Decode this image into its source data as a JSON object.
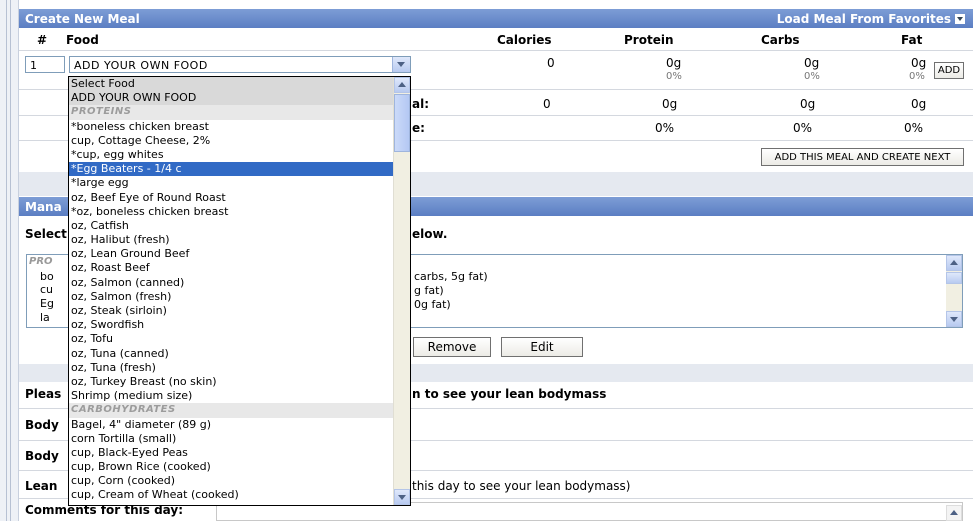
{
  "create_meal": {
    "title": "Create New Meal",
    "load_favorites": "Load Meal From Favorites",
    "columns": {
      "num": "#",
      "food": "Food",
      "calories": "Calories",
      "protein": "Protein",
      "carbs": "Carbs",
      "fat": "Fat"
    },
    "row": {
      "number": "1",
      "food_value": "ADD YOUR OWN FOOD",
      "calories": "0",
      "protein": "0g",
      "protein_pct": "0%",
      "carbs": "0g",
      "carbs_pct": "0%",
      "fat": "0g",
      "fat_pct": "0%",
      "add_label": "ADD"
    },
    "totals": {
      "label_fragment": "al:",
      "calories": "0",
      "protein": "0g",
      "carbs": "0g",
      "fat": "0g"
    },
    "percentages": {
      "label_fragment": "e:",
      "protein": "0%",
      "carbs": "0%",
      "fat": "0%"
    },
    "add_meal_next": "ADD THIS MEAL AND CREATE NEXT"
  },
  "dropdown": {
    "items": [
      {
        "label": "Select Food",
        "kind": "shaded"
      },
      {
        "label": "ADD YOUR OWN FOOD",
        "kind": "shaded"
      },
      {
        "label": "PROTEINS",
        "kind": "group"
      },
      {
        "label": "*boneless chicken breast",
        "kind": "item"
      },
      {
        "label": "cup, Cottage Cheese, 2%",
        "kind": "item"
      },
      {
        "label": "*cup, egg whites",
        "kind": "item"
      },
      {
        "label": "*Egg Beaters - 1/4 c",
        "kind": "selected"
      },
      {
        "label": "*large egg",
        "kind": "item"
      },
      {
        "label": "oz, Beef Eye of Round Roast",
        "kind": "item"
      },
      {
        "label": "*oz, boneless chicken breast",
        "kind": "item"
      },
      {
        "label": "oz, Catfish",
        "kind": "item"
      },
      {
        "label": "oz, Halibut (fresh)",
        "kind": "item"
      },
      {
        "label": "oz, Lean Ground Beef",
        "kind": "item"
      },
      {
        "label": "oz, Roast Beef",
        "kind": "item"
      },
      {
        "label": "oz, Salmon (canned)",
        "kind": "item"
      },
      {
        "label": "oz, Salmon (fresh)",
        "kind": "item"
      },
      {
        "label": "oz, Steak (sirloin)",
        "kind": "item"
      },
      {
        "label": "oz, Swordfish",
        "kind": "item"
      },
      {
        "label": "oz, Tofu",
        "kind": "item"
      },
      {
        "label": "oz, Tuna (canned)",
        "kind": "item"
      },
      {
        "label": "oz, Tuna (fresh)",
        "kind": "item"
      },
      {
        "label": "oz, Turkey Breast (no skin)",
        "kind": "item"
      },
      {
        "label": "Shrimp (medium size)",
        "kind": "item"
      },
      {
        "label": "CARBOHYDRATES",
        "kind": "group"
      },
      {
        "label": "Bagel, 4\" diameter (89 g)",
        "kind": "item"
      },
      {
        "label": "corn Tortilla (small)",
        "kind": "item"
      },
      {
        "label": "cup, Black-Eyed Peas",
        "kind": "item"
      },
      {
        "label": "cup, Brown Rice (cooked)",
        "kind": "item"
      },
      {
        "label": "cup, Corn (cooked)",
        "kind": "item"
      },
      {
        "label": "cup, Cream of Wheat (cooked)",
        "kind": "item"
      }
    ]
  },
  "manage": {
    "title_fragment": "Mana",
    "instruction_left": "Select",
    "instruction_right": "elow.",
    "left_fragments": [
      "PRO",
      "bo",
      "cu",
      "Eg",
      "la"
    ],
    "right_lines": [
      "carbs, 5g fat)",
      "g fat)",
      "0g fat)"
    ],
    "remove_label": "Remove",
    "edit_label": "Edit"
  },
  "body_section": {
    "please_left": "Pleas",
    "please_right": "n to see your lean bodymass",
    "body_left_1": "Body",
    "body_left_2": "Body",
    "lean_left": "Lean",
    "lean_right": "this day to see your lean bodymass)",
    "comments_label": "Comments for this day:"
  }
}
